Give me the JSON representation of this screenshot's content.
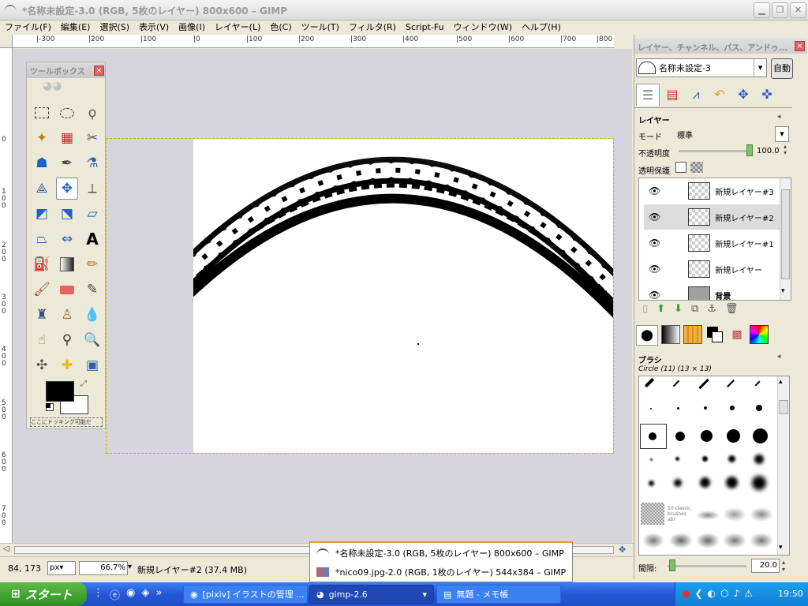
{
  "window": {
    "title": "*名称未設定-3.0 (RGB, 5枚のレイヤー) 800x600 – GIMP"
  },
  "menubar": [
    "ファイル(F)",
    "編集(E)",
    "選択(S)",
    "表示(V)",
    "画像(I)",
    "レイヤー(L)",
    "色(C)",
    "ツール(T)",
    "フィルタ(R)",
    "Script-Fu",
    "ウィンドウ(W)",
    "ヘルプ(H)"
  ],
  "ruler": {
    "h_labels": [
      "|-300",
      "|200",
      "|100",
      "|0",
      "|100",
      "|200",
      "|300",
      "|400",
      "|500",
      "|600",
      "|700",
      "|800"
    ],
    "v_labels": [
      "0",
      "1 0 0",
      "2 0 0",
      "3 0 0",
      "4 0 0",
      "5 0 0",
      "6 0 0",
      "7 0 0"
    ]
  },
  "toolbox": {
    "title": "ツールボックス",
    "close": "×",
    "dropzone": "ここにドッキング可能だ",
    "fg_color": "#000000",
    "bg_color": "#ffffff"
  },
  "status": {
    "coords": "84, 173",
    "unit": "px",
    "zoom": "66.7%",
    "info": "新規レイヤー#2 (37.4 MB)"
  },
  "dock": {
    "title": "レイヤー、チャンネル、パス、アンドゥ...",
    "image_select": "名称未設定-3",
    "auto_button": "自動",
    "layers_label": "レイヤー",
    "mode_label": "モード",
    "mode_value": "標準",
    "opacity_label": "不透明度",
    "opacity_value": "100.0",
    "lock_label": "透明保護",
    "layers": [
      {
        "name": "新規レイヤー#3",
        "selected": false
      },
      {
        "name": "新規レイヤー#2",
        "selected": true
      },
      {
        "name": "新規レイヤー#1",
        "selected": false
      },
      {
        "name": "新規レイヤー",
        "selected": false
      },
      {
        "name": "背景",
        "selected": false
      }
    ],
    "brush_label": "ブラシ",
    "brush_name": "Circle (11) (13 × 13)",
    "spacing_label": "間隔:",
    "spacing_value": "20.0",
    "brush_sample_label": "50 classic brushes abr"
  },
  "popup": {
    "items": [
      "*名称未設定-3.0 (RGB, 5枚のレイヤー) 800x600 – GIMP",
      "*nico09.jpg-2.0 (RGB, 1枚のレイヤー) 544x384 – GIMP"
    ]
  },
  "taskbar": {
    "start": "スタート",
    "tasks": [
      "[pixiv] イラストの管理 ...",
      "gimp-2.6",
      "無題 - メモ帳"
    ],
    "clock": "19:50"
  }
}
